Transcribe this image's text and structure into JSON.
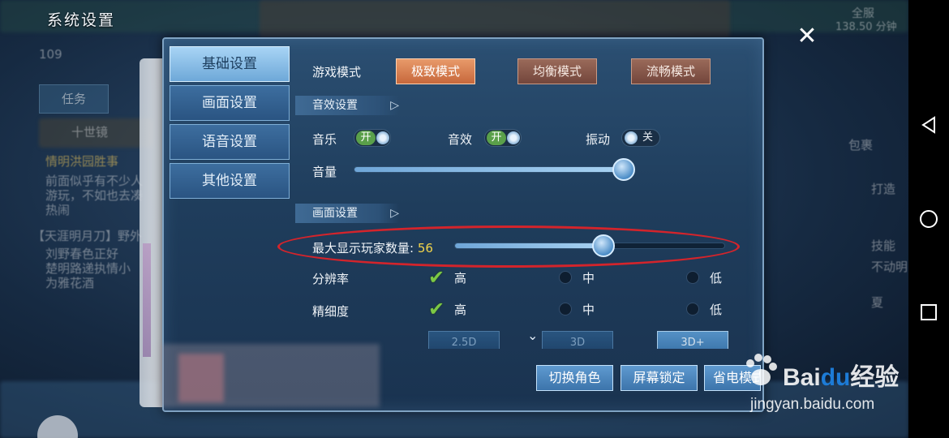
{
  "window": {
    "title": "系统设置",
    "close_icon": "close-icon"
  },
  "nav": {
    "items": [
      {
        "label": "基础设置",
        "active": true
      },
      {
        "label": "画面设置",
        "active": false
      },
      {
        "label": "语音设置",
        "active": false
      },
      {
        "label": "其他设置",
        "active": false
      }
    ]
  },
  "game_mode": {
    "label": "游戏模式",
    "options": [
      {
        "label": "极致模式",
        "active": true
      },
      {
        "label": "均衡模式",
        "active": false
      },
      {
        "label": "流畅模式",
        "active": false
      }
    ]
  },
  "audio_section": {
    "header": "音效设置",
    "music": {
      "label": "音乐",
      "state": "开"
    },
    "sfx": {
      "label": "音效",
      "state": "开"
    },
    "vibration": {
      "label": "振动",
      "state": "关"
    },
    "volume": {
      "label": "音量",
      "value_percent": 100
    }
  },
  "graphics_section": {
    "header": "画面设置",
    "max_players": {
      "label": "最大显示玩家数量:",
      "value": "56",
      "value_percent": 55
    },
    "resolution": {
      "label": "分辨率",
      "options": [
        "高",
        "中",
        "低"
      ],
      "selected": "高"
    },
    "detail": {
      "label": "精细度",
      "options": [
        "高",
        "中",
        "低"
      ],
      "selected": "高"
    },
    "render_modes": [
      {
        "label": "2.5D",
        "active": false
      },
      {
        "label": "3D",
        "active": false
      },
      {
        "label": "3D+",
        "active": true
      }
    ]
  },
  "actions": {
    "switch_role": "切换角色",
    "lock_screen": "屏幕锁定",
    "power_save": "省电模式"
  },
  "background": {
    "top_texts": [
      "系统设置",
      "全服",
      "138.50 分钟"
    ],
    "level": "109",
    "tabs": [
      "任务"
    ],
    "left_texts": [
      "十世镜",
      "情明洪园胜事",
      "前面似乎有不少人",
      "游玩，不如也去凑",
      "热闹",
      "【天涯明月刀】野外",
      "刘野春色正好",
      "楚明路递执情小",
      "为雅花酒"
    ],
    "right_texts": [
      "包裹",
      "打造",
      "技能",
      "不动明",
      "夏"
    ]
  },
  "watermark": {
    "brand": "Bai",
    "brand2": "du",
    "suffix": "经验",
    "url": "jingyan.baidu.com"
  },
  "colors": {
    "accent_orange": "#c7683c",
    "panel_bg": "#1f3d5c",
    "annotation_red": "#d4242b",
    "check_green": "#7cc845"
  }
}
